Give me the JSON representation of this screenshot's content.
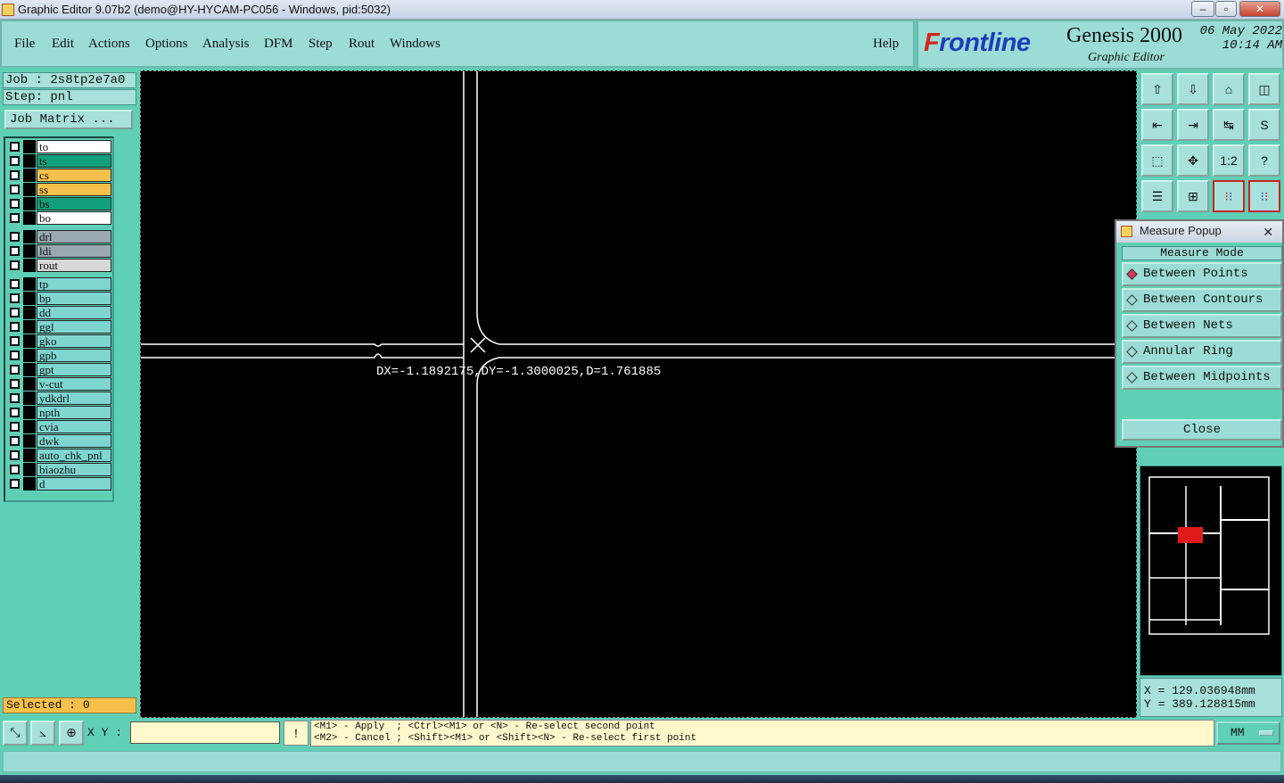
{
  "window": {
    "title": "Graphic Editor 9.07b2 (demo@HY-HYCAM-PC056 - Windows, pid:5032)",
    "minimize_icon": "minimize-icon",
    "maximize_icon": "maximize-icon",
    "close_icon": "close-icon"
  },
  "menu": {
    "file": "File",
    "edit": "Edit",
    "actions": "Actions",
    "options": "Options",
    "analysis": "Analysis",
    "dfm": "DFM",
    "step": "Step",
    "rout": "Rout",
    "windows": "Windows",
    "help": "Help"
  },
  "brand": {
    "logo_first": "F",
    "logo_rest": "rontline",
    "product": "Genesis 2000",
    "subtitle": "Graphic Editor",
    "date": "06 May 2022",
    "time": "10:14 AM"
  },
  "job": {
    "job_label": "Job : 2s8tp2e7a0",
    "step_label": "Step: pnl",
    "matrix_button": "Job Matrix ..."
  },
  "layers": [
    {
      "name": "to",
      "color": "#ffffff"
    },
    {
      "name": "ts",
      "color": "#12a07a"
    },
    {
      "name": "cs",
      "color": "#f7c04a"
    },
    {
      "name": "ss",
      "color": "#f7c04a"
    },
    {
      "name": "bs",
      "color": "#12a07a"
    },
    {
      "name": "bo",
      "color": "#ffffff"
    },
    {
      "name": "drl",
      "color": "#9aa8b0"
    },
    {
      "name": "ldi",
      "color": "#9aa8b0"
    },
    {
      "name": "rout",
      "color": "#d8d8d8"
    },
    {
      "name": "tp",
      "color": "#7fd6d0"
    },
    {
      "name": "bp",
      "color": "#7fd6d0"
    },
    {
      "name": "dd",
      "color": "#7fd6d0"
    },
    {
      "name": "ggl",
      "color": "#7fd6d0"
    },
    {
      "name": "gko",
      "color": "#7fd6d0"
    },
    {
      "name": "gpb",
      "color": "#7fd6d0"
    },
    {
      "name": "gpt",
      "color": "#7fd6d0"
    },
    {
      "name": "v-cut",
      "color": "#7fd6d0"
    },
    {
      "name": "ydkdrl",
      "color": "#7fd6d0"
    },
    {
      "name": "npth",
      "color": "#7fd6d0"
    },
    {
      "name": "cvia",
      "color": "#7fd6d0"
    },
    {
      "name": "dwk",
      "color": "#7fd6d0"
    },
    {
      "name": "auto_chk_pnl",
      "color": "#7fd6d0"
    },
    {
      "name": "biaozhu",
      "color": "#7fd6d0"
    },
    {
      "name": "d",
      "color": "#7fd6d0"
    }
  ],
  "selected": "Selected : 0",
  "canvas": {
    "measurement": "DX=-1.1892175,DY=-1.3000025,D=1.761885"
  },
  "toolbar": {
    "icons": [
      "zoom-home-icon",
      "zoom-prev-icon",
      "home-icon",
      "panel-icon",
      "pan-left-icon",
      "pan-right-icon",
      "flip-icon",
      "snap-icon",
      "fit-icon",
      "center-icon",
      "scale-1-2-icon",
      "help-icon",
      "settings-icon",
      "grid-icon",
      "layers-red-icon",
      "layers-red-2-icon"
    ],
    "scale_label": "1:2",
    "help_label": "?"
  },
  "measure_popup": {
    "title": "Measure Popup",
    "mode_header": "Measure Mode",
    "options": [
      {
        "label": "Between Points",
        "selected": true
      },
      {
        "label": "Between Contours",
        "selected": false
      },
      {
        "label": "Between Nets",
        "selected": false
      },
      {
        "label": "Annular Ring",
        "selected": false
      },
      {
        "label": "Between Midpoints",
        "selected": false
      }
    ],
    "close": "Close"
  },
  "coordinates": {
    "x": "X = 129.036948mm",
    "y": "Y = 389.128815mm"
  },
  "bottom": {
    "xy_label": "X Y :",
    "xy_value": "",
    "alert_icon": "!",
    "message_line1": "<M1> - Apply  ; <Ctrl><M1> or <N> - Re-select second point",
    "message_line2": "<M2> - Cancel ; <Shift><M1> or <Shift><N> - Re-select first point",
    "units": "MM"
  },
  "colors": {
    "panel": "#5fcfb6",
    "menu": "#9cdcd6",
    "canvas": "#000000",
    "message_bg": "#fff8cc",
    "selected_bg": "#f7c04a"
  }
}
